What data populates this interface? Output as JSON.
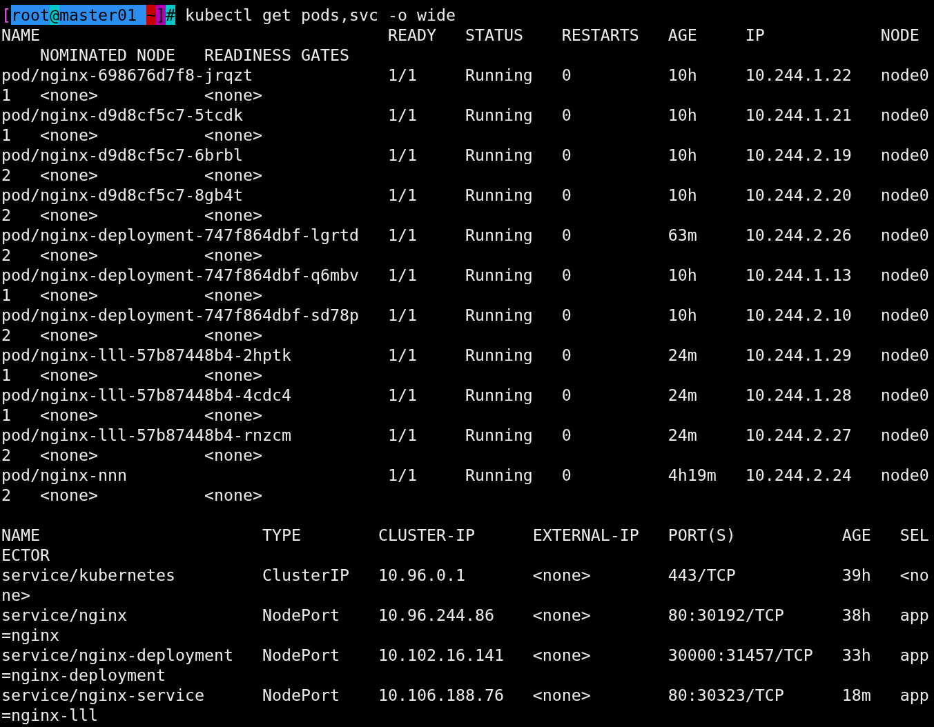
{
  "prompt": [
    {
      "text": "[",
      "kind": "fg",
      "color": "#ff55ff"
    },
    {
      "text": "root",
      "kind": "bg",
      "color": "#2a8ff0"
    },
    {
      "text": "@",
      "kind": "bg",
      "color": "#00c8c8"
    },
    {
      "text": "master01 ",
      "kind": "bg",
      "color": "#2a8ff0"
    },
    {
      "text": "~",
      "kind": "bg",
      "color": "#c80000"
    },
    {
      "text": "]",
      "kind": "bg",
      "color": "#b400b4"
    },
    {
      "text": "#",
      "kind": "bg",
      "color": "#00c8c8"
    }
  ],
  "command": " kubectl get pods,svc -o wide",
  "pods_output": [
    "NAME                                    READY   STATUS    RESTARTS   AGE     IP            NODE",
    "    NOMINATED NODE   READINESS GATES",
    "pod/nginx-698676d7f8-jrqzt              1/1     Running   0          10h     10.244.1.22   node0",
    "1   <none>           <none>",
    "pod/nginx-d9d8cf5c7-5tcdk               1/1     Running   0          10h     10.244.1.21   node0",
    "1   <none>           <none>",
    "pod/nginx-d9d8cf5c7-6brbl               1/1     Running   0          10h     10.244.2.19   node0",
    "2   <none>           <none>",
    "pod/nginx-d9d8cf5c7-8gb4t               1/1     Running   0          10h     10.244.2.20   node0",
    "2   <none>           <none>",
    "pod/nginx-deployment-747f864dbf-lgrtd   1/1     Running   0          63m     10.244.2.26   node0",
    "2   <none>           <none>",
    "pod/nginx-deployment-747f864dbf-q6mbv   1/1     Running   0          10h     10.244.1.13   node0",
    "1   <none>           <none>",
    "pod/nginx-deployment-747f864dbf-sd78p   1/1     Running   0          10h     10.244.2.10   node0",
    "2   <none>           <none>",
    "pod/nginx-lll-57b87448b4-2hptk          1/1     Running   0          24m     10.244.1.29   node0",
    "1   <none>           <none>",
    "pod/nginx-lll-57b87448b4-4cdc4          1/1     Running   0          24m     10.244.1.28   node0",
    "1   <none>           <none>",
    "pod/nginx-lll-57b87448b4-rnzcm          1/1     Running   0          24m     10.244.2.27   node0",
    "2   <none>           <none>",
    "pod/nginx-nnn                           1/1     Running   0          4h19m   10.244.2.24   node0",
    "2   <none>           <none>"
  ],
  "services_output": [
    "NAME                       TYPE        CLUSTER-IP      EXTERNAL-IP   PORT(S)           AGE   SEL",
    "ECTOR",
    "service/kubernetes         ClusterIP   10.96.0.1       <none>        443/TCP           39h   <no",
    "ne>",
    "service/nginx              NodePort    10.96.244.86    <none>        80:30192/TCP      38h   app",
    "=nginx",
    "service/nginx-deployment   NodePort    10.102.16.141   <none>        30000:31457/TCP   33h   app",
    "=nginx-deployment",
    "service/nginx-service      NodePort    10.106.188.76   <none>        80:30323/TCP      18m   app",
    "=nginx-lll"
  ]
}
